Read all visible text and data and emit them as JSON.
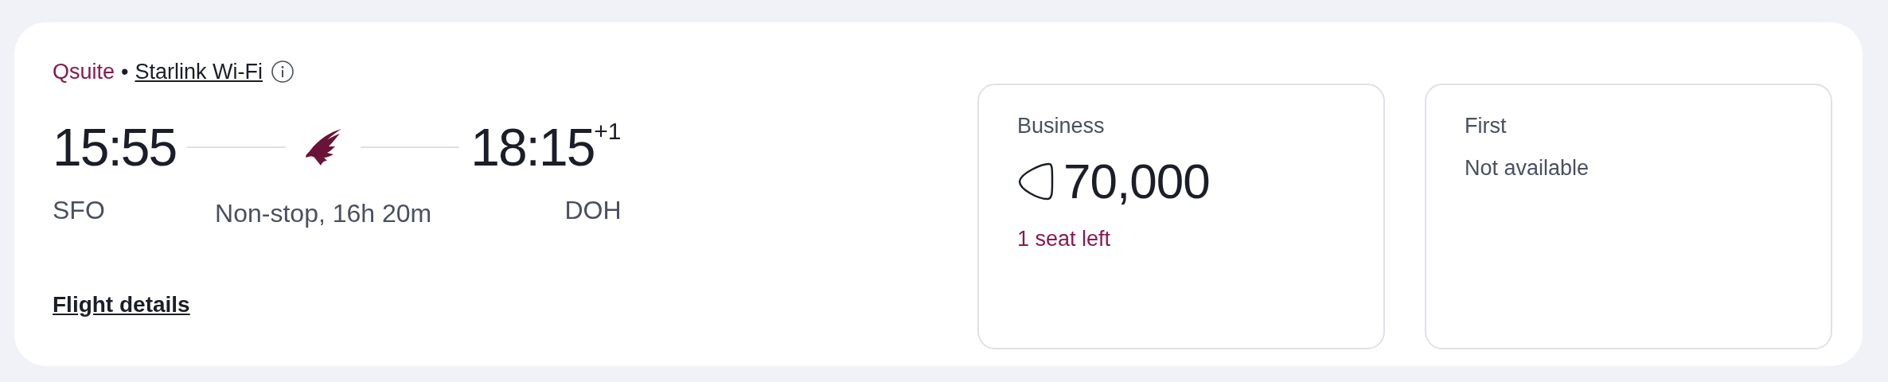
{
  "flight": {
    "cabin_product": "Qsuite",
    "separator": "•",
    "wifi_link": "Starlink Wi-Fi",
    "departure": {
      "time": "15:55",
      "airport": "SFO"
    },
    "arrival": {
      "time": "18:15",
      "day_offset": "+1",
      "airport": "DOH"
    },
    "duration": "Non-stop, 16h 20m",
    "details_link": "Flight details"
  },
  "fares": [
    {
      "kind": "price",
      "cabin": "Business",
      "amount": "70,000",
      "note": "1 seat left"
    },
    {
      "kind": "unavailable",
      "cabin": "First",
      "status": "Not available"
    }
  ]
}
